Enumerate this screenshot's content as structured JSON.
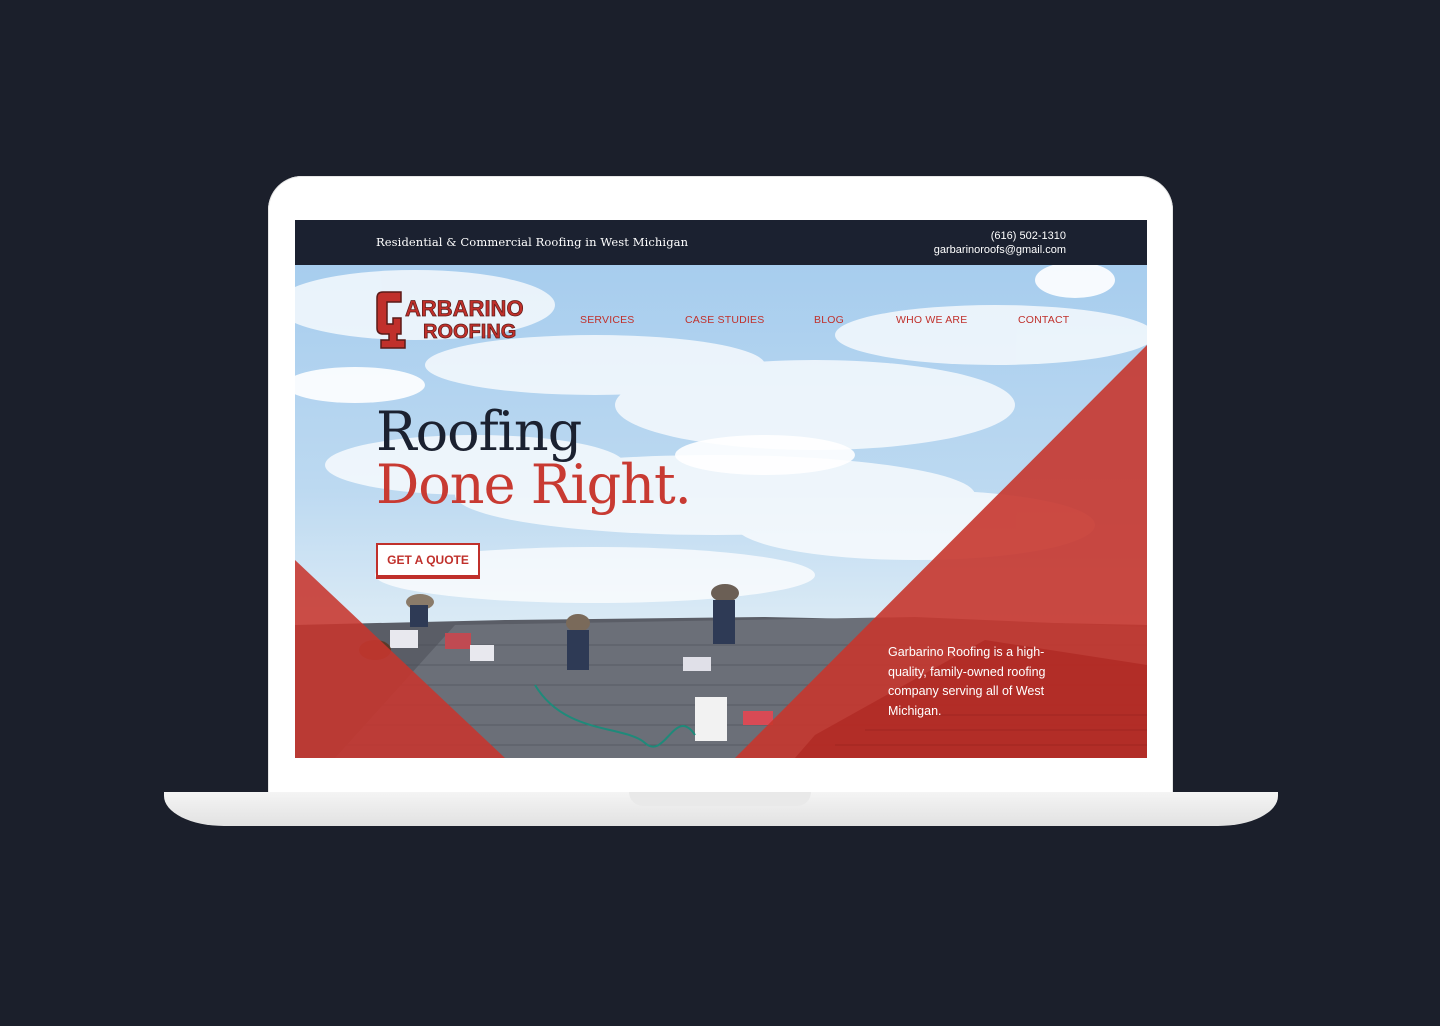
{
  "topbar": {
    "tagline": "Residential & Commercial Roofing in West Michigan",
    "phone": "(616) 502-1310",
    "email": "garbarinoroofs@gmail.com"
  },
  "logo": {
    "line1": "ARBARINO",
    "line2": "ROOFING"
  },
  "nav": {
    "items": [
      "SERVICES",
      "CASE STUDIES",
      "BLOG",
      "WHO WE ARE",
      "CONTACT"
    ]
  },
  "hero": {
    "headline_line1": "Roofing",
    "headline_line2": "Done Right.",
    "cta_label": "GET A QUOTE",
    "description": "Garbarino Roofing is a high-quality, family-owned roofing company serving all of West Michigan."
  },
  "colors": {
    "page_bg": "#1b1f2b",
    "topbar_bg": "#1b2130",
    "accent_red": "#c0302b",
    "headline_dark": "#1b2130"
  }
}
